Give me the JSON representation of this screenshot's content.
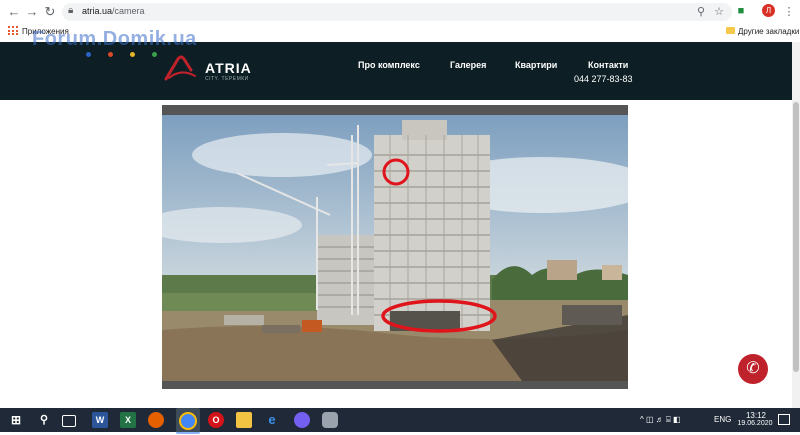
{
  "browser": {
    "url_host": "atria.ua",
    "url_path": "/camera",
    "bookmarks_apps": "Приложения",
    "bookmarks_other": "Другие закладки",
    "profile_initial": "Л"
  },
  "watermark": {
    "text": "Forum.Domik.ua",
    "dot_colors": [
      "#2b64c6",
      "#d94a2a",
      "#e7b526",
      "#3aa04a"
    ]
  },
  "header": {
    "brand": "ATRIA",
    "brand_sub": "CITY. ТЕРЕМКИ",
    "nav": [
      "Про комплекс",
      "Галерея",
      "Квартири",
      "Контакти"
    ],
    "phone": "044 277-83-83"
  },
  "camera": {
    "annotation_color": "#e0151b"
  },
  "taskbar": {
    "lang": "ENG",
    "time": "13:12",
    "date": "19.06.2020"
  },
  "colors": {
    "header_bg": "#0d1f24",
    "accent": "#c0222b"
  }
}
